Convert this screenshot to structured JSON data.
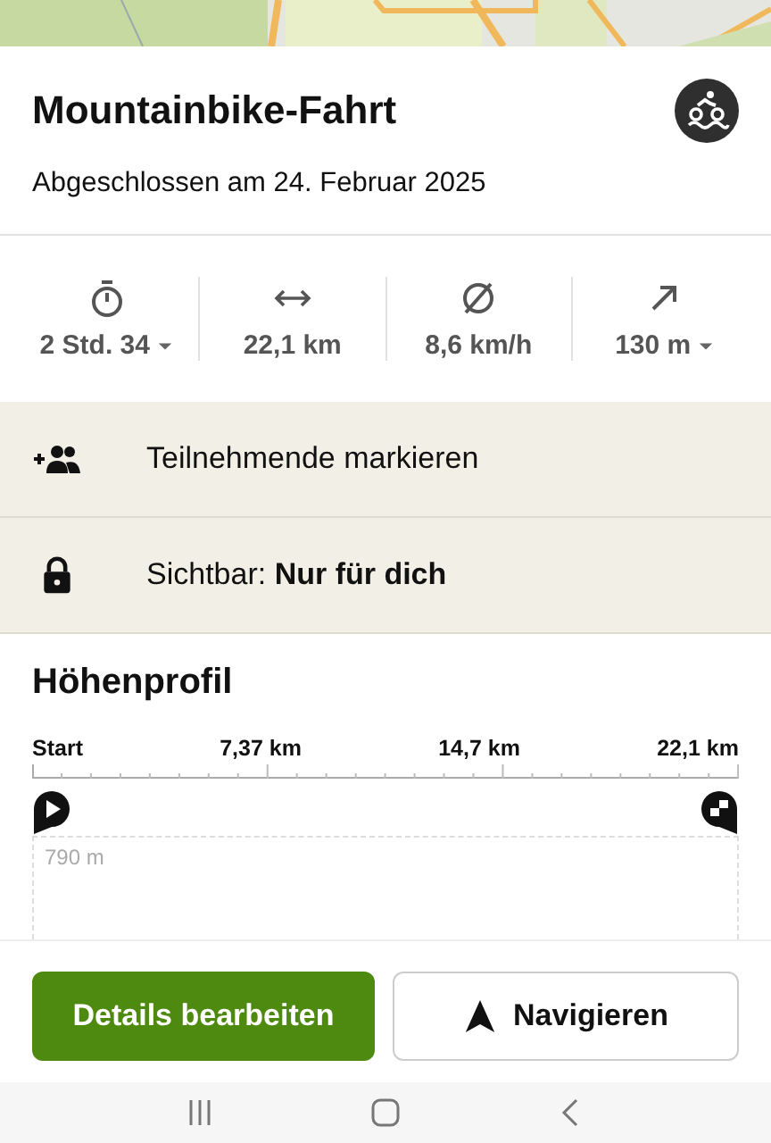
{
  "activity": {
    "title": "Mountainbike-Fahrt",
    "subtitle": "Abgeschlossen am 24. Februar 2025"
  },
  "stats": [
    {
      "kind": "duration",
      "value": "2 Std. 34",
      "dropdown": true
    },
    {
      "kind": "distance",
      "value": "22,1 km",
      "dropdown": false
    },
    {
      "kind": "average",
      "value": "8,6 km/h",
      "dropdown": false
    },
    {
      "kind": "ascent",
      "value": "130 m",
      "dropdown": true
    }
  ],
  "actions": [
    {
      "kind": "people",
      "label": "Teilnehmende markieren"
    },
    {
      "kind": "lock",
      "label": "Sichtbar: **Nur für dich**"
    }
  ],
  "elevation": {
    "title": "Höhenprofil",
    "ticks": [
      "Start",
      "7,37 km",
      "14,7 km",
      "22,1 km"
    ],
    "y_label": "790 m"
  },
  "buttons": [
    {
      "kind": "primary",
      "label": "Details bearbeiten"
    },
    {
      "kind": "navigate",
      "label": "Navigieren"
    }
  ]
}
